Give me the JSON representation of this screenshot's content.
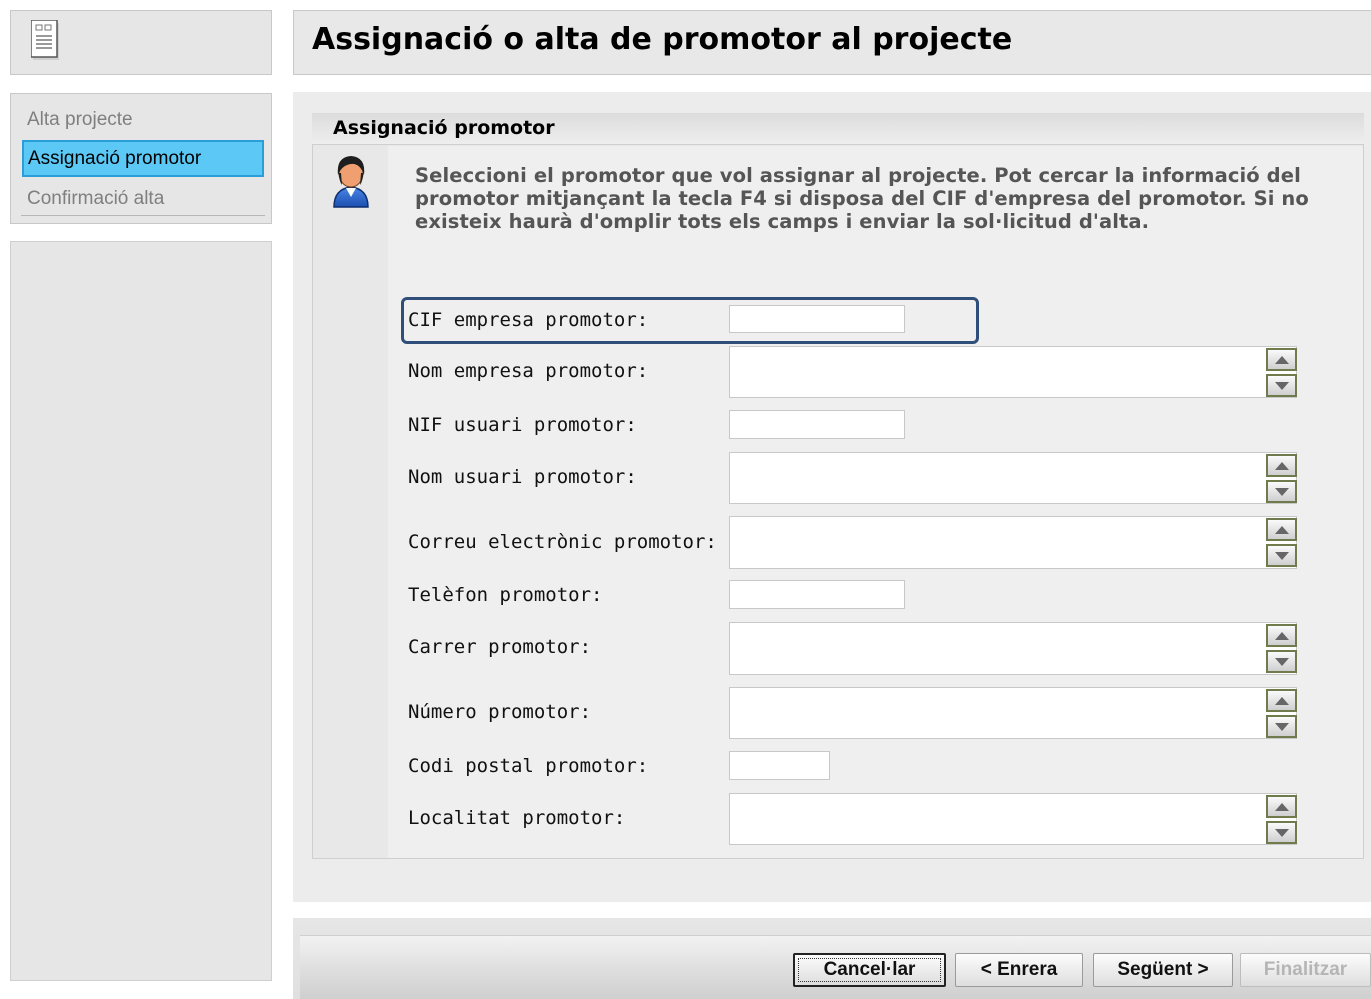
{
  "header": {
    "title": "Assignació o alta de promotor al projecte"
  },
  "sidebar": {
    "items": [
      {
        "label": "Alta projecte",
        "active": false
      },
      {
        "label": "Assignació promotor",
        "active": true
      },
      {
        "label": "Confirmació alta",
        "active": false
      }
    ]
  },
  "section": {
    "title": "Assignació promotor",
    "intro": "Seleccioni el promotor que vol assignar al projecte. Pot cercar la informació del promotor mitjançant la tecla F4 si disposa del CIF d'empresa del promotor. Si no existeix haurà d'omplir tots els camps i enviar la sol·licitud d'alta."
  },
  "form": {
    "cif": {
      "label": "CIF empresa promotor:",
      "value": ""
    },
    "nom_empresa": {
      "label": "Nom empresa promotor:",
      "value": ""
    },
    "nif_usuari": {
      "label": "NIF usuari promotor:",
      "value": ""
    },
    "nom_usuari": {
      "label": "Nom usuari promotor:",
      "value": ""
    },
    "correu": {
      "label": "Correu electrònic promotor:",
      "value": ""
    },
    "telefon": {
      "label": "Telèfon promotor:",
      "value": ""
    },
    "carrer": {
      "label": "Carrer promotor:",
      "value": ""
    },
    "numero": {
      "label": "Número promotor:",
      "value": ""
    },
    "codi_postal": {
      "label": "Codi postal promotor:",
      "value": ""
    },
    "localitat": {
      "label": "Localitat promotor:",
      "value": ""
    }
  },
  "footer": {
    "cancel": "Cancel·lar",
    "back": "< Enrera",
    "next": "Següent >",
    "finish": "Finalitzar"
  },
  "colors": {
    "active_nav": "#5bc8f5",
    "highlight_border": "#2f4f7a",
    "spinner_border": "#6f7b4d"
  },
  "icons": {
    "header": "document-icon",
    "section": "user-icon",
    "spinner_up": "arrow-up-icon",
    "spinner_down": "arrow-down-icon"
  }
}
